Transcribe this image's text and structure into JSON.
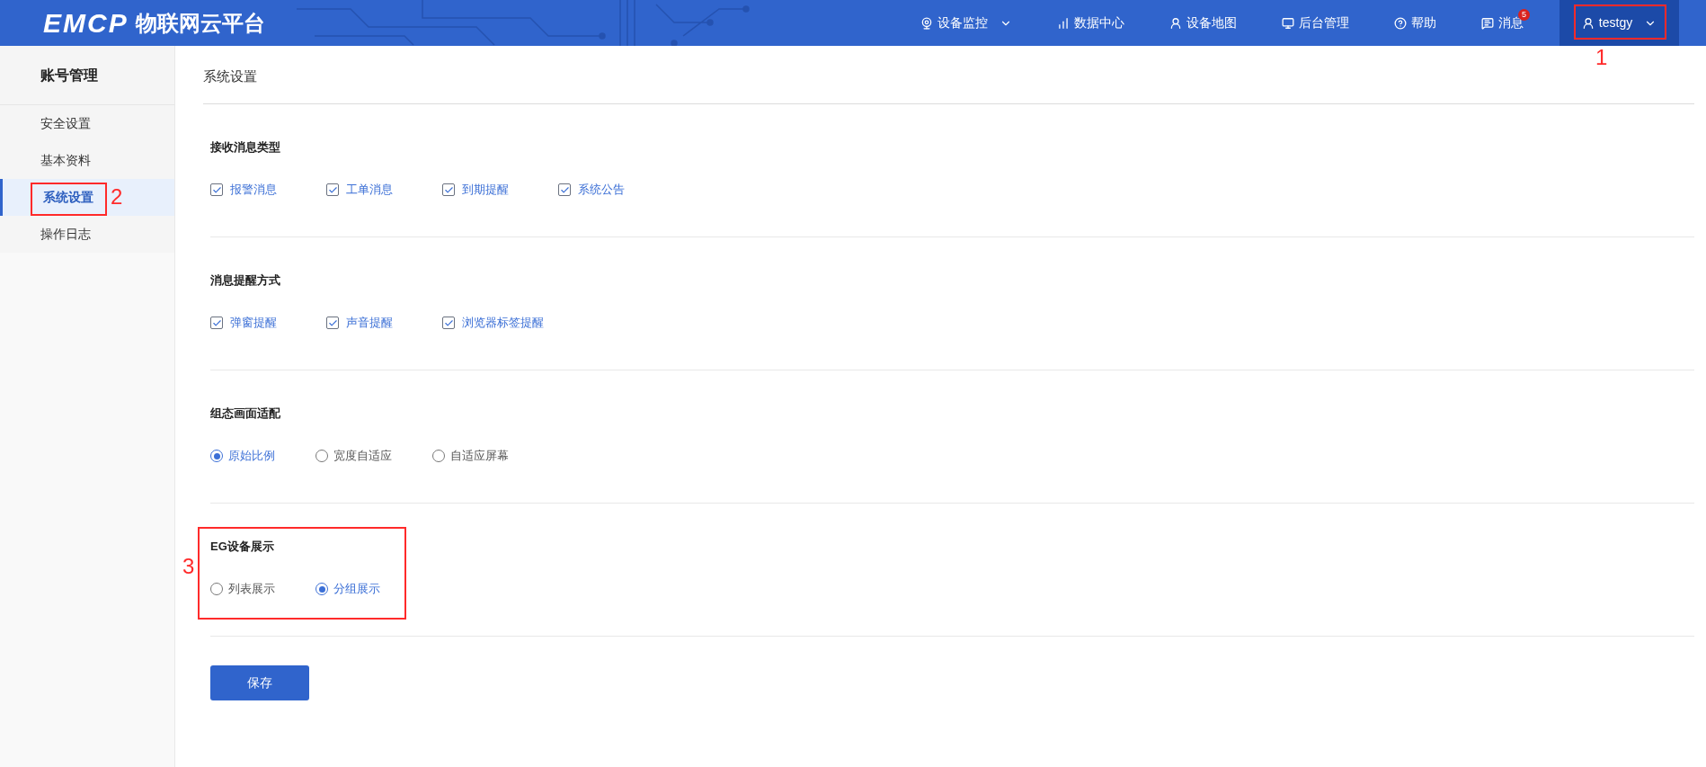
{
  "header": {
    "logo": "EMCP",
    "platform_name": "物联网云平台",
    "nav": [
      {
        "label": "设备监控",
        "dropdown": true
      },
      {
        "label": "数据中心",
        "dropdown": false
      },
      {
        "label": "设备地图",
        "dropdown": false
      },
      {
        "label": "后台管理",
        "dropdown": false
      },
      {
        "label": "帮助",
        "dropdown": false
      },
      {
        "label": "消息",
        "dropdown": false,
        "badge": "5"
      }
    ],
    "user": {
      "name": "testgy",
      "dropdown": true,
      "annotation": "1"
    }
  },
  "sidebar": {
    "title": "账号管理",
    "items": [
      {
        "label": "安全设置",
        "selected": false
      },
      {
        "label": "基本资料",
        "selected": false
      },
      {
        "label": "系统设置",
        "selected": true,
        "annotation": "2"
      },
      {
        "label": "操作日志",
        "selected": false
      }
    ]
  },
  "content": {
    "title": "系统设置",
    "sections": [
      {
        "title": "接收消息类型",
        "kind": "checkbox",
        "options": [
          {
            "label": "报警消息",
            "checked": true
          },
          {
            "label": "工单消息",
            "checked": true
          },
          {
            "label": "到期提醒",
            "checked": true
          },
          {
            "label": "系统公告",
            "checked": true
          }
        ]
      },
      {
        "title": "消息提醒方式",
        "kind": "checkbox",
        "options": [
          {
            "label": "弹窗提醒",
            "checked": true
          },
          {
            "label": "声音提醒",
            "checked": true
          },
          {
            "label": "浏览器标签提醒",
            "checked": true
          }
        ]
      },
      {
        "title": "组态画面适配",
        "kind": "radio",
        "options": [
          {
            "label": "原始比例",
            "selected": true
          },
          {
            "label": "宽度自适应",
            "selected": false
          },
          {
            "label": "自适应屏幕",
            "selected": false
          }
        ]
      },
      {
        "title": "EG设备展示",
        "kind": "radio",
        "annotation": "3",
        "options": [
          {
            "label": "列表展示",
            "selected": false
          },
          {
            "label": "分组展示",
            "selected": true
          }
        ]
      }
    ],
    "save_button": "保存"
  }
}
